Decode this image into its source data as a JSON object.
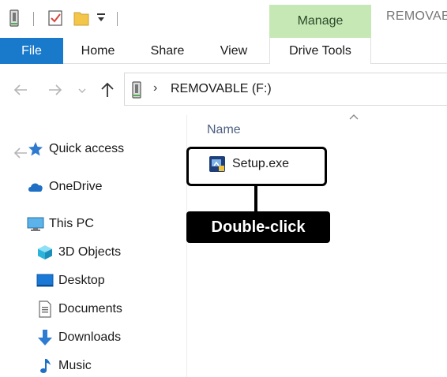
{
  "title_bar": {
    "contextual_tab": "Manage",
    "window_title": "REMOVAB"
  },
  "ribbon": {
    "tabs": [
      {
        "label": "File"
      },
      {
        "label": "Home"
      },
      {
        "label": "Share"
      },
      {
        "label": "View"
      },
      {
        "label": "Drive Tools"
      }
    ]
  },
  "address_bar": {
    "path": "REMOVABLE (F:)",
    "separator": "›"
  },
  "nav_pane": {
    "items": [
      {
        "label": "Quick access",
        "icon": "star-icon"
      },
      {
        "label": "OneDrive",
        "icon": "cloud-icon"
      },
      {
        "label": "This PC",
        "icon": "computer-icon"
      },
      {
        "label": "3D Objects",
        "icon": "cube-icon"
      },
      {
        "label": "Desktop",
        "icon": "desktop-icon"
      },
      {
        "label": "Documents",
        "icon": "document-icon"
      },
      {
        "label": "Downloads",
        "icon": "download-icon"
      },
      {
        "label": "Music",
        "icon": "music-icon"
      }
    ]
  },
  "file_list": {
    "column_name": "Name",
    "files": [
      {
        "name": "Setup.exe",
        "icon": "installer-icon"
      }
    ]
  },
  "annotation": {
    "callout": "Double-click"
  },
  "colors": {
    "file_tab": "#1979ca",
    "manage_tab": "#c6e8b4",
    "header_text": "#4d6082"
  }
}
